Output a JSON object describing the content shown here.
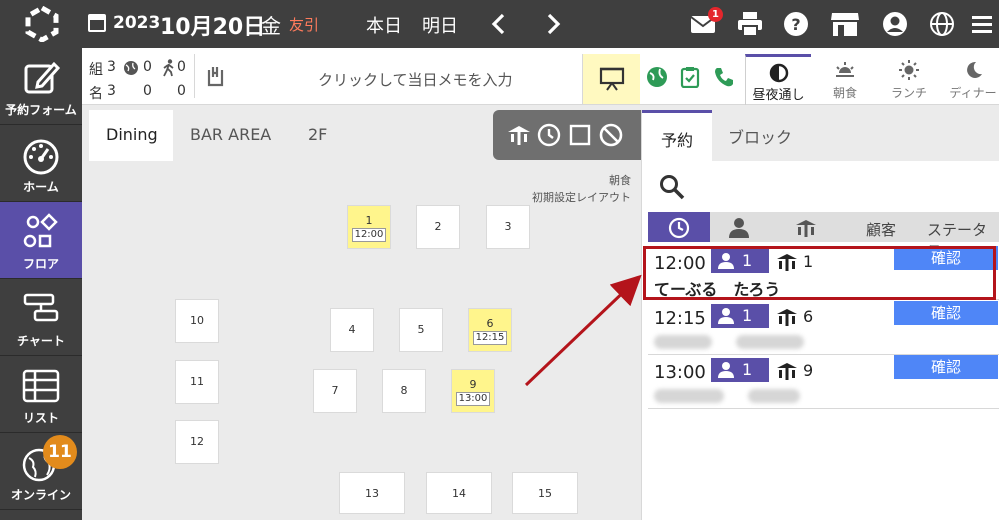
{
  "header": {
    "year": "2023",
    "month_day": "10月20日",
    "weekday": "金",
    "rokuyo": "友引",
    "today_label": "本日",
    "tomorrow_label": "明日",
    "mail_badge": "1",
    "icons": [
      "logo-icon",
      "calendar-icon",
      "arrow-left-icon",
      "arrow-right-icon",
      "mail-icon",
      "print-icon",
      "help-icon",
      "store-icon",
      "account-icon",
      "globe-icon",
      "menu-icon"
    ]
  },
  "sidebar": {
    "items": [
      {
        "label": "予約フォーム",
        "icon": "edit-icon"
      },
      {
        "label": "ホーム",
        "icon": "dashboard-icon"
      },
      {
        "label": "フロア",
        "icon": "shapes-icon"
      },
      {
        "label": "チャート",
        "icon": "chart-icon"
      },
      {
        "label": "リスト",
        "icon": "table-icon"
      },
      {
        "label": "オンライン",
        "icon": "globe-icon"
      }
    ],
    "online_badge": "11",
    "active_index": 2
  },
  "infobar": {
    "groups_label": "組",
    "people_label": "名",
    "groups": {
      "total": "3",
      "web": "0",
      "walkin": "0"
    },
    "people": {
      "total": "3",
      "web": "0",
      "walkin": "0"
    },
    "memo_placeholder": "クリックして当日メモを入力",
    "meal_tabs": [
      {
        "label": "昼夜通し",
        "icon": "half-circle-icon",
        "active": true
      },
      {
        "label": "朝食",
        "icon": "sunrise-icon",
        "active": false
      },
      {
        "label": "ランチ",
        "icon": "sun-icon",
        "active": false
      },
      {
        "label": "ディナー",
        "icon": "moon-icon",
        "active": false
      }
    ]
  },
  "floor": {
    "tabs": [
      {
        "label": "Dining",
        "active": true
      },
      {
        "label": "BAR AREA",
        "active": false
      },
      {
        "label": "2F",
        "active": false
      }
    ],
    "layout_meal": "朝食",
    "layout_name": "初期設定レイアウト",
    "tables": [
      {
        "num": "1",
        "time": "12:00"
      },
      {
        "num": "2",
        "time": ""
      },
      {
        "num": "3",
        "time": ""
      },
      {
        "num": "4",
        "time": ""
      },
      {
        "num": "5",
        "time": ""
      },
      {
        "num": "6",
        "time": "12:15"
      },
      {
        "num": "7",
        "time": ""
      },
      {
        "num": "8",
        "time": ""
      },
      {
        "num": "9",
        "time": "13:00"
      },
      {
        "num": "10",
        "time": ""
      },
      {
        "num": "11",
        "time": ""
      },
      {
        "num": "12",
        "time": ""
      },
      {
        "num": "13",
        "time": ""
      },
      {
        "num": "14",
        "time": ""
      },
      {
        "num": "15",
        "time": ""
      }
    ]
  },
  "panel": {
    "tabs": [
      {
        "label": "予約",
        "active": true
      },
      {
        "label": "ブロック",
        "active": false
      }
    ],
    "columns": {
      "customer": "顧客",
      "status": "ステータス"
    },
    "reservations": [
      {
        "time": "12:00",
        "guests": "1",
        "table": "1",
        "status": "確認",
        "name": "てーぶる　たろう"
      },
      {
        "time": "12:15",
        "guests": "1",
        "table": "6",
        "status": "確認",
        "name": ""
      },
      {
        "time": "13:00",
        "guests": "1",
        "table": "9",
        "status": "確認",
        "name": ""
      }
    ]
  },
  "colors": {
    "header_bg": "#3f3f3f",
    "accent_purple": "#5a4fa8",
    "status_blue": "#4f86f7",
    "highlight_red": "#b4141b",
    "occupied_yellow": "#fff58c",
    "badge_orange": "#e28b1c"
  }
}
